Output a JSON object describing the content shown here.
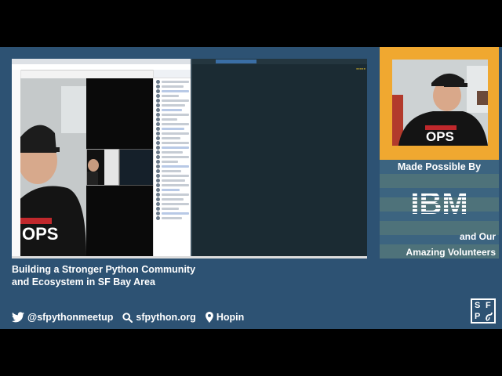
{
  "headline": {
    "line1": "Building a Stronger Python Community",
    "line2": "and Ecosystem in SF Bay Area"
  },
  "links": [
    {
      "icon": "twitter-icon",
      "label": "@sfpythonmeetup"
    },
    {
      "icon": "search-icon",
      "label": "sfpython.org"
    },
    {
      "icon": "map-pin-icon",
      "label": "Hopin"
    }
  ],
  "sponsor": {
    "made_possible": "Made Possible By",
    "company": "IBM",
    "and_our": "and Our",
    "volunteers": "Amazing Volunteers"
  },
  "logo": {
    "letters": [
      "S",
      "F",
      "P"
    ]
  },
  "presenter_shirt_text": "OPS",
  "colors": {
    "frame": "#2d5273",
    "sidebar": "#f0a830",
    "sponsor_band": "#3c6480",
    "text": "#ffffff"
  }
}
